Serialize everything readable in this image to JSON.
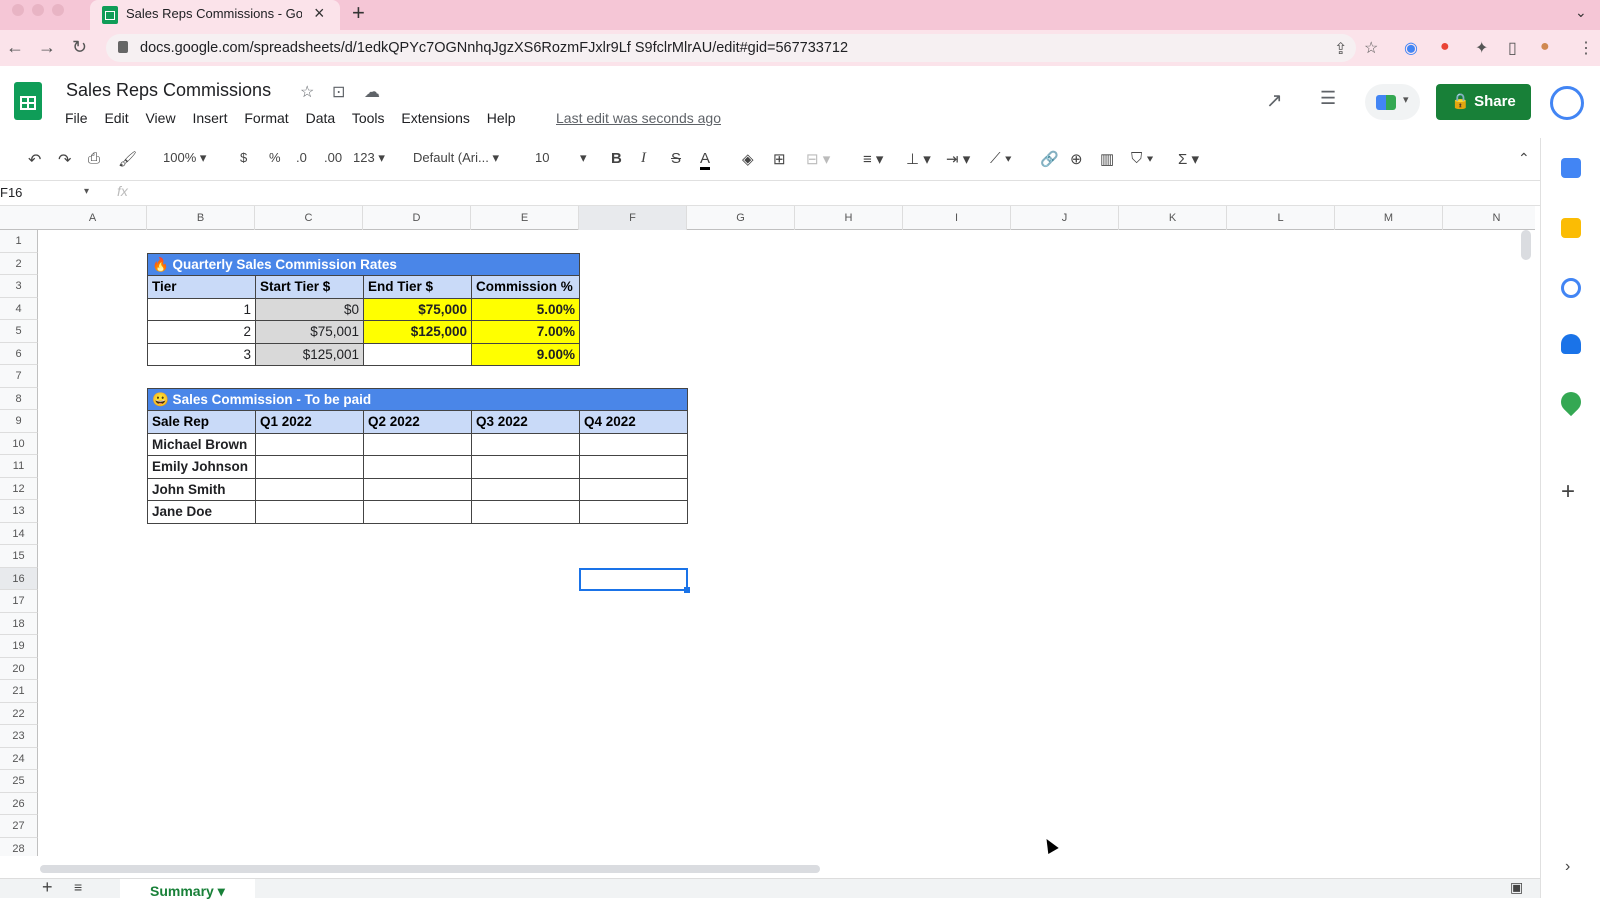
{
  "browser": {
    "tab_title": "Sales Reps Commissions - Goo",
    "url": "docs.google.com/spreadsheets/d/1edkQPYc7OGNnhqJgzXS6RozmFJxlr9Lf S9fclrMlrAU/edit#gid=567733712"
  },
  "doc": {
    "title": "Sales Reps Commissions",
    "menu": [
      "File",
      "Edit",
      "View",
      "Insert",
      "Format",
      "Data",
      "Tools",
      "Extensions",
      "Help"
    ],
    "last_edit": "Last edit was seconds ago",
    "share_label": "Share"
  },
  "toolbar": {
    "zoom": "100%",
    "currency": "$",
    "percent": "%",
    "dec_decrease": ".0",
    "dec_increase": ".00",
    "format_more": "123",
    "font": "Default (Ari...",
    "font_size": "10",
    "bold": "B",
    "italic": "I",
    "strike": "S",
    "text_color": "A"
  },
  "formula_bar": {
    "name_box": "F16",
    "fx": "fx"
  },
  "grid": {
    "columns": [
      "A",
      "B",
      "C",
      "D",
      "E",
      "F",
      "G",
      "H",
      "I",
      "J",
      "K",
      "L",
      "M",
      "N"
    ],
    "rows": [
      "1",
      "2",
      "3",
      "4",
      "5",
      "6",
      "7",
      "8",
      "9",
      "10",
      "11",
      "12",
      "13",
      "14",
      "15",
      "16",
      "17",
      "18",
      "19",
      "20",
      "21",
      "22",
      "23",
      "24",
      "25",
      "26",
      "27",
      "28"
    ],
    "selected_cell": "F16"
  },
  "rates_table": {
    "title": "Quarterly Sales Commission Rates",
    "headers": [
      "Tier",
      "Start Tier $",
      "End Tier $",
      "Commission %"
    ],
    "rows": [
      [
        "1",
        "$0",
        "$75,000",
        "5.00%"
      ],
      [
        "2",
        "$75,001",
        "$125,000",
        "7.00%"
      ],
      [
        "3",
        "$125,001",
        "",
        "9.00%"
      ]
    ]
  },
  "commission_table": {
    "title": "Sales Commission - To be paid",
    "headers": [
      "Sale Rep",
      "Q1 2022",
      "Q2 2022",
      "Q3 2022",
      "Q4 2022"
    ],
    "reps": [
      "Michael Brown",
      "Emily Johnson",
      "John Smith",
      "Jane Doe"
    ]
  },
  "sheet_tab": {
    "label": "Summary"
  },
  "colors": {
    "accent_green": "#188038",
    "header_blue": "#4a86e8",
    "header_light_blue": "#c9daf8",
    "highlight_yellow": "#ffff00"
  }
}
